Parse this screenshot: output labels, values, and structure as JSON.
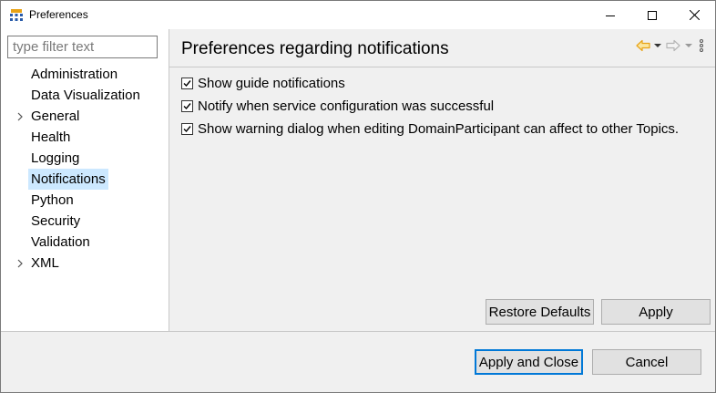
{
  "window": {
    "title": "Preferences"
  },
  "sidebar": {
    "filter_placeholder": "type filter text",
    "items": [
      {
        "label": "Administration",
        "expandable": false
      },
      {
        "label": "Data Visualization",
        "expandable": false
      },
      {
        "label": "General",
        "expandable": true
      },
      {
        "label": "Health",
        "expandable": false
      },
      {
        "label": "Logging",
        "expandable": false
      },
      {
        "label": "Notifications",
        "expandable": false,
        "selected": true
      },
      {
        "label": "Python",
        "expandable": false
      },
      {
        "label": "Security",
        "expandable": false
      },
      {
        "label": "Validation",
        "expandable": false
      },
      {
        "label": "XML",
        "expandable": true
      }
    ]
  },
  "page": {
    "title": "Preferences regarding notifications",
    "options": [
      {
        "label": "Show guide notifications",
        "checked": true
      },
      {
        "label": "Notify when service configuration was successful",
        "checked": true
      },
      {
        "label": "Show warning dialog when editing DomainParticipant can affect to other Topics.",
        "checked": true
      }
    ],
    "restore_defaults_label": "Restore Defaults",
    "apply_label": "Apply"
  },
  "footer": {
    "apply_close_label": "Apply and Close",
    "cancel_label": "Cancel"
  },
  "colors": {
    "selection": "#cce8ff",
    "accent": "#0078d7",
    "nav_back_icon": "#e8a317"
  },
  "icons": [
    "app-icon",
    "minimize-icon",
    "maximize-icon",
    "close-icon",
    "chevron-right-icon",
    "back-arrow-icon",
    "forward-arrow-icon",
    "dropdown-arrow-icon",
    "view-menu-icon",
    "checkmark-icon"
  ]
}
